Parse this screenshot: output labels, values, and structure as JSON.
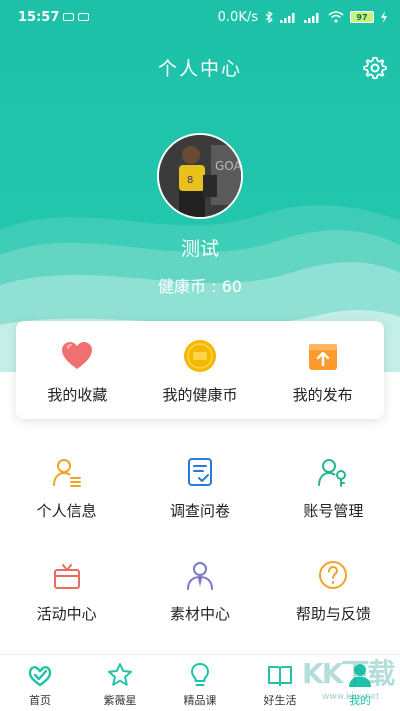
{
  "status_bar": {
    "time": "15:57",
    "network_speed": "0.0K/s",
    "battery": "97"
  },
  "header": {
    "title": "个人中心",
    "settings_icon": "gear-icon"
  },
  "profile": {
    "name": "测试",
    "coins_label": "健康币 : 60"
  },
  "quick_card": {
    "items": [
      {
        "label": "我的收藏",
        "icon": "heart-icon",
        "color": "#f07070"
      },
      {
        "label": "我的健康币",
        "icon": "coin-icon",
        "color": "#f5b800"
      },
      {
        "label": "我的发布",
        "icon": "publish-icon",
        "color": "#ff9a2e"
      }
    ]
  },
  "grid": {
    "items": [
      {
        "label": "个人信息",
        "icon": "person-info-icon",
        "color": "#f0a326"
      },
      {
        "label": "调查问卷",
        "icon": "survey-icon",
        "color": "#2a7bd8"
      },
      {
        "label": "账号管理",
        "icon": "account-manage-icon",
        "color": "#27b58f"
      },
      {
        "label": "活动中心",
        "icon": "gift-icon",
        "color": "#ec6b5f"
      },
      {
        "label": "素材中心",
        "icon": "material-icon",
        "color": "#7c79c8"
      },
      {
        "label": "帮助与反馈",
        "icon": "help-icon",
        "color": "#f0a326"
      }
    ]
  },
  "tabbar": {
    "items": [
      {
        "label": "首页",
        "icon": "home-icon"
      },
      {
        "label": "紫薇星",
        "icon": "star-icon"
      },
      {
        "label": "精品课",
        "icon": "bulb-icon"
      },
      {
        "label": "好生活",
        "icon": "book-icon"
      },
      {
        "label": "我的",
        "icon": "me-icon",
        "active": true
      }
    ]
  },
  "watermark": {
    "text": "KK下载",
    "url": "www.kkx.net"
  },
  "colors": {
    "accent": "#1ec3a9"
  }
}
